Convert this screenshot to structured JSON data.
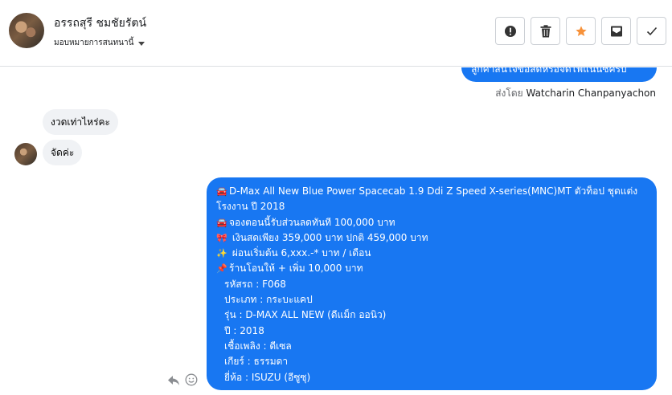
{
  "header": {
    "name": "อรรถสุรี ชมชัยรัตน์",
    "assign_label": "มอบหมายการสนทนานี้",
    "actions": [
      {
        "id": "report",
        "icon": "alert-icon"
      },
      {
        "id": "delete",
        "icon": "trash-icon"
      },
      {
        "id": "star",
        "icon": "star-icon",
        "color": "#f7923a"
      },
      {
        "id": "archive",
        "icon": "archive-icon"
      },
      {
        "id": "done",
        "icon": "check-icon"
      }
    ]
  },
  "thread": {
    "top_outgoing_partial": "ลูกค้าสนใจข้อสดหรือจัดไฟแนนซ์ครับ",
    "sent_by_prefix": "ส่งโดย",
    "sent_by_name": "Watcharin Chanpanyachon",
    "incoming": [
      "งวดเท่าไหร่คะ",
      "จัดค่ะ"
    ],
    "outgoing": {
      "line1_emoji": "🚘",
      "line1": "D-Max All New Blue Power Spacecab 1.9 Ddi Z Speed X-series(MNC)MT ตัวท็อป ชุดแต่งโรงงาน ปี 2018",
      "line2_emoji": "🚘",
      "line2": "จองตอนนี้รับส่วนลดทันที 100,000 บาท",
      "line3_emoji": "🎀",
      "line3": " เงินสดเพียง 359,000 บาท ปกติ 459,000 บาท",
      "line4_emoji": "✨",
      "line4": " ผ่อนเริ่มต้น 6,xxx.-* บาท / เดือน",
      "line5_emoji": "📌",
      "line5": "ร้านโอนให้ + เพิ่ม 10,000 บาท",
      "details": [
        "รหัสรถ : F068",
        "ประเภท : กระบะแคป",
        "รุ่น : D-MAX ALL NEW (ดีแม็ก ออนิว)",
        "ปี : 2018",
        "เชื้อเพลิง : ดีเซล",
        "เกียร์ : ธรรมดา",
        "ยี่ห้อ : ISUZU (อีซูซุ)"
      ]
    }
  },
  "colors": {
    "messenger_blue": "#1877f2",
    "incoming_gray": "#f0f2f5",
    "star_orange": "#f7923a"
  }
}
